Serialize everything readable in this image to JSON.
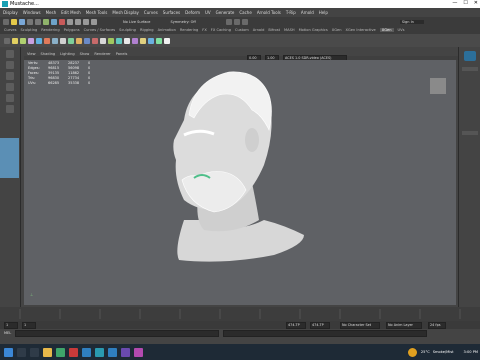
{
  "titlebar": {
    "title": "Mustache..."
  },
  "menu": [
    "Display",
    "Windows",
    "Mesh",
    "Edit Mesh",
    "Mesh Tools",
    "Mesh Display",
    "Curves",
    "Surfaces",
    "Deform",
    "UV",
    "Generate",
    "Cache",
    "Arnold Tools",
    "T-Rip",
    "Arnold",
    "Help"
  ],
  "statusline": {
    "no_live_surface": "No Live Surface",
    "symmetry": "Symmetry: Off",
    "sign_in": "Sign In"
  },
  "shelf_tabs": [
    "Curves",
    "Sculpting",
    "Rendering",
    "Polygons",
    "Curves / Surfaces",
    "Sculpting",
    "Rigging",
    "Animation",
    "Rendering",
    "FX",
    "FX Caching",
    "Custom",
    "Arnold",
    "Bifrost",
    "MASH",
    "Motion Graphics",
    "XGen",
    "XGen Interactive",
    "UVs",
    "Fur",
    "VRay",
    "TURTLE"
  ],
  "shelf_active": "XGen",
  "viewport_menu": [
    "View",
    "Shading",
    "Lighting",
    "Show",
    "Renderer",
    "Panels"
  ],
  "viewport_fields": {
    "val1": "0.00",
    "val2": "1.00",
    "colorspace": "ACES 1.0 SDR-video (ACES)"
  },
  "hud": {
    "rows": [
      {
        "label": "Verts:",
        "a": "48373",
        "b": "28237",
        "c": "0"
      },
      {
        "label": "Edges:",
        "a": "96815",
        "b": "56098",
        "c": "0"
      },
      {
        "label": "Faces:",
        "a": "39135",
        "b": "11862",
        "c": "0"
      },
      {
        "label": "Tris:",
        "a": "96830",
        "b": "27734",
        "c": "0"
      },
      {
        "label": "UVs:",
        "a": "66285",
        "b": "35338",
        "c": "0"
      }
    ]
  },
  "range": {
    "start": "1",
    "end": "1",
    "start_field": "474.TP",
    "end_field": "474.TP",
    "char_set": "No Character Set",
    "anim_layer": "No Anim Layer",
    "fps": "24 fps"
  },
  "cmdline": {
    "label": "MEL"
  },
  "taskbar": {
    "temp": "25°C",
    "weather": "Smoke/Mist",
    "time": "3:00 PM"
  },
  "colors": {
    "viewport": "#5f6165",
    "accent": "#5b8fb5",
    "taskbar": "#1e2a36"
  }
}
